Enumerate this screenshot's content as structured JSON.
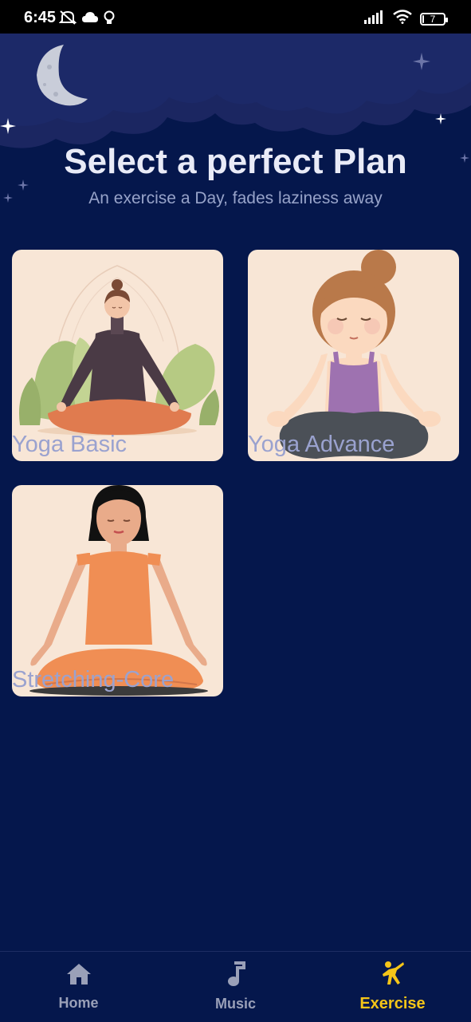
{
  "status_bar": {
    "time": "6:45",
    "battery_level": "7",
    "icons": [
      "mute-icon",
      "cloud-icon",
      "bulb-icon",
      "signal-icon",
      "wifi-icon",
      "battery-icon"
    ]
  },
  "header": {
    "title": "Select a perfect Plan",
    "subtitle": "An exercise a Day, fades laziness away"
  },
  "plans": [
    {
      "label": "Yoga Basic"
    },
    {
      "label": "Yoga Advance"
    },
    {
      "label": "Stretching-Core"
    }
  ],
  "bottom_nav": {
    "items": [
      {
        "label": "Home",
        "icon": "home-icon"
      },
      {
        "label": "Music",
        "icon": "music-note-icon"
      },
      {
        "label": "Exercise",
        "icon": "exercise-icon"
      }
    ],
    "active": "Exercise"
  },
  "colors": {
    "background": "#05174c",
    "accent": "#f5c518",
    "nav_inactive": "#9aa0b8",
    "card_bg": "#f8e6d6"
  }
}
